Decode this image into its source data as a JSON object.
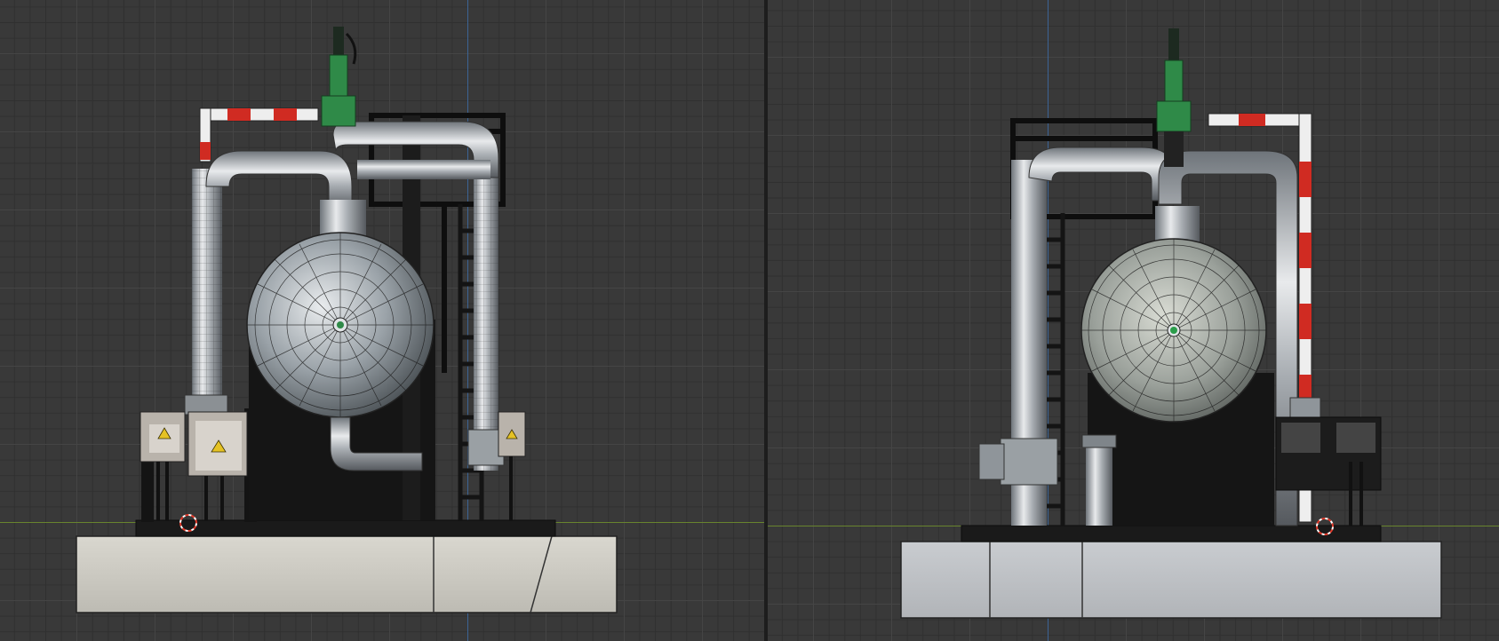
{
  "app": {
    "views": [
      "front-view",
      "side-view"
    ]
  },
  "colors": {
    "background": "#393939",
    "grid_minor": "#303030",
    "grid_major": "#454545",
    "axis_vertical": "#3a6fb0",
    "axis_horizontal": "#6f8f2a",
    "pipe_steel": "#9ea4aa",
    "pipe_highlight": "#e6e8ea",
    "safety_red": "#d02b22",
    "valve_green": "#2f8a48",
    "concrete": "#cfcdc6",
    "frame_black": "#141414"
  },
  "icons": {
    "origin": "3d-cursor-icon",
    "warning": "warning-sign-icon"
  }
}
